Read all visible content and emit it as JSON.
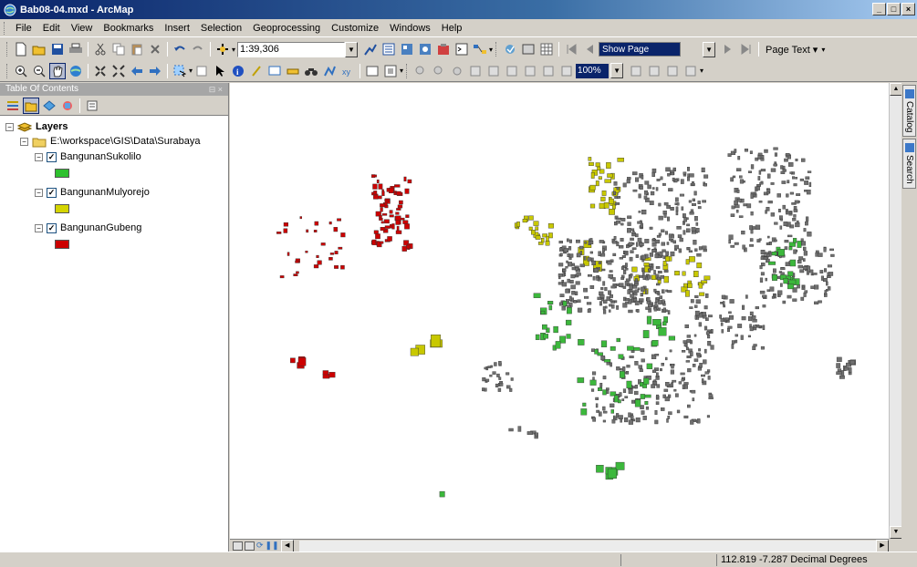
{
  "window": {
    "title": "Bab08-04.mxd - ArcMap",
    "buttons": [
      "_",
      "□",
      "×"
    ]
  },
  "menu": [
    "File",
    "Edit",
    "View",
    "Bookmarks",
    "Insert",
    "Selection",
    "Geoprocessing",
    "Customize",
    "Windows",
    "Help"
  ],
  "toolbar": {
    "scale": "1:39,306",
    "show_page": "Show Page",
    "zoom_percent": "100%",
    "page_text": "Page Text ▾"
  },
  "toc": {
    "title": "Table Of Contents",
    "root": "Layers",
    "folder": "E:\\workspace\\GIS\\Data\\Surabaya",
    "layers": [
      {
        "name": "BangunanSukolilo",
        "color": "#2ec02e"
      },
      {
        "name": "BangunanMulyorejo",
        "color": "#d4d400"
      },
      {
        "name": "BangunanGubeng",
        "color": "#cc0000"
      }
    ]
  },
  "dock": {
    "catalog": "Catalog",
    "search": "Search"
  },
  "status": {
    "coords": "112.819  -7.287 Decimal Degrees"
  },
  "colors": {
    "gray": "#707070",
    "green": "#3cb83c",
    "yellow": "#c8c800",
    "red": "#cc0000"
  }
}
